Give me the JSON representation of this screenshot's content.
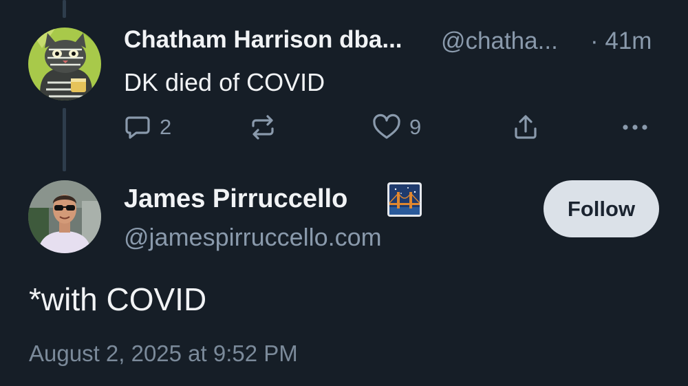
{
  "parent_post": {
    "author_name": "Chatham Harrison dba...",
    "handle": "@chatha...",
    "time": "· 41m",
    "text": "DK died of COVID",
    "avatar_icon": "cat-illustration-avatar",
    "actions": {
      "reply_count": "2",
      "like_count": "9"
    }
  },
  "reply_post": {
    "author_name": "James Pirruccello",
    "name_emoji": "bridge-at-night-emoji",
    "handle": "@jamespirruccello.com",
    "follow_label": "Follow",
    "text": "*with COVID",
    "date": "August 2, 2025 at 9:52 PM",
    "avatar_icon": "person-photo-avatar"
  },
  "colors": {
    "background": "#161e27",
    "text_primary": "#f1f3f5",
    "text_secondary": "#8a9aac",
    "follow_button_bg": "#dbe1e8",
    "thread_line": "#2e3d4c"
  }
}
